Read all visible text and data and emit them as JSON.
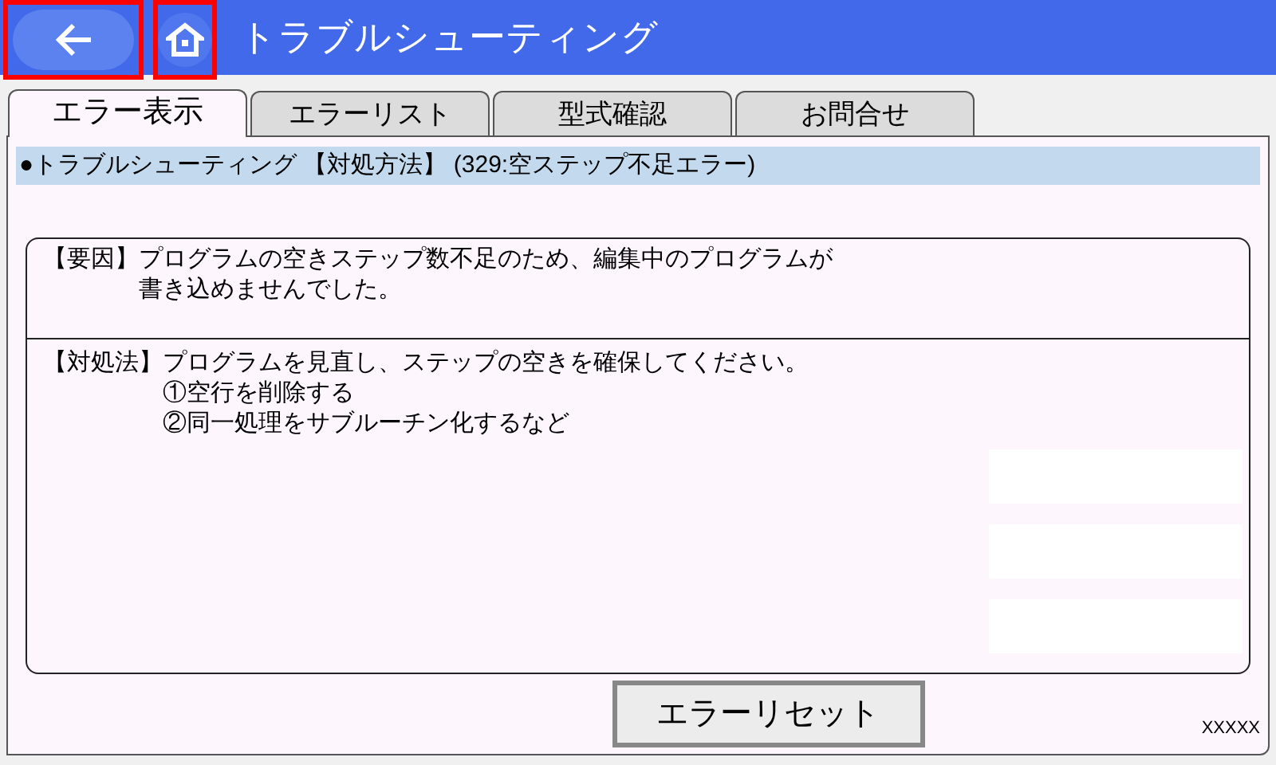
{
  "header": {
    "title": "トラブルシューティング",
    "back_highlighted": true,
    "home_highlighted": true
  },
  "tabs": [
    {
      "label": "エラー表示",
      "selected": true
    },
    {
      "label": "エラーリスト",
      "selected": false
    },
    {
      "label": "型式確認",
      "selected": false
    },
    {
      "label": "お問合せ",
      "selected": false
    }
  ],
  "heading": "●トラブルシューティング 【対処方法】 (329:空ステップ不足エラー)",
  "sections": [
    {
      "label": "【要因】",
      "lines": [
        "プログラムの空きステップ数不足のため、編集中のプログラムが",
        "書き込めませんでした。"
      ]
    },
    {
      "label": "【対処法】",
      "lines": [
        "プログラムを見直し、ステップの空きを確保してください。",
        "①空行を削除する",
        "②同一処理をサブルーチン化するなど"
      ]
    }
  ],
  "reset_button": "エラーリセット",
  "footer_code": "XXXXX"
}
